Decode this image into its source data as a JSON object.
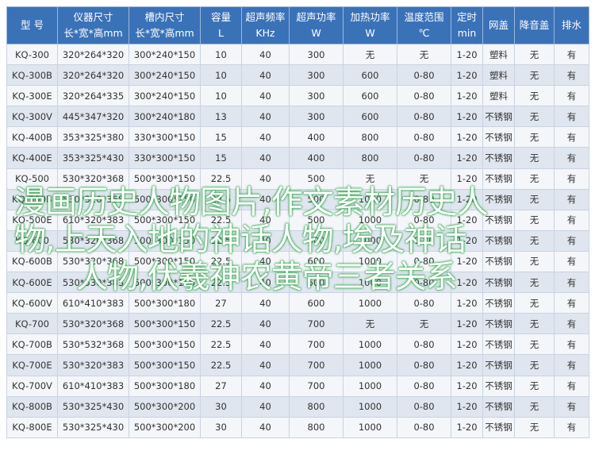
{
  "headers": [
    [
      "型 号"
    ],
    [
      "仪器尺寸",
      "长*宽*高mm"
    ],
    [
      "槽内尺寸",
      "长*宽*高mm"
    ],
    [
      "容量",
      "L"
    ],
    [
      "超声频率",
      "KHz"
    ],
    [
      "超声功率",
      "W"
    ],
    [
      "加热功率",
      "W"
    ],
    [
      "温度范围",
      "℃"
    ],
    [
      "定时",
      "min"
    ],
    [
      "网盖"
    ],
    [
      "降音盖"
    ],
    [
      "排水"
    ]
  ],
  "rows": [
    [
      "KQ-300",
      "320*264*320",
      "300*240*150",
      "10",
      "40",
      "300",
      "无",
      "无",
      "1-20",
      "塑料",
      "无",
      "有"
    ],
    [
      "KQ-300B",
      "320*264*320",
      "300*240*150",
      "10",
      "40",
      "300",
      "600",
      "0-80",
      "1-20",
      "塑料",
      "无",
      "有"
    ],
    [
      "KQ-300E",
      "320*264*335",
      "300*240*150",
      "10",
      "40",
      "300",
      "600",
      "0-80",
      "1-20",
      "塑料",
      "无",
      "有"
    ],
    [
      "KQ-300V",
      "445*347*320",
      "300*240*180",
      "13",
      "40",
      "300",
      "600",
      "0-80",
      "1-20",
      "不锈钢",
      "无",
      "有"
    ],
    [
      "KQ-400B",
      "353*325*380",
      "330*300*150",
      "15",
      "40",
      "400",
      "800",
      "0-80",
      "1-20",
      "不锈钢",
      "无",
      "有"
    ],
    [
      "KQ-400E",
      "353*325*430",
      "330*300*150",
      "15",
      "40",
      "400",
      "800",
      "0-80",
      "1-20",
      "不锈钢",
      "无",
      "有"
    ],
    [
      "KQ-500",
      "530*320*368",
      "500*300*150",
      "22.5",
      "40",
      "500",
      "无",
      "无",
      "1-20",
      "不锈钢",
      "无",
      "有"
    ],
    [
      "KQ-500B",
      "530*320*368",
      "500*300*150",
      "22.5",
      "40",
      "500",
      "1000",
      "0-80",
      "1-20",
      "不锈钢",
      "无",
      "有"
    ],
    [
      "KQ-500E",
      "610*320*383",
      "500*300*150",
      "22.5",
      "40",
      "500",
      "1000",
      "0-80",
      "1-20",
      "不锈钢",
      "无",
      "有"
    ],
    [
      "KQ-600",
      "530*320*368",
      "500*300*150",
      "22.5",
      "40",
      "600",
      "1000",
      "0-80",
      "1-20",
      "不锈钢",
      "无",
      "有"
    ],
    [
      "KQ-600B",
      "530*320*368",
      "500*300*150",
      "22.5",
      "40",
      "600",
      "1000",
      "0-80",
      "1-20",
      "不锈钢",
      "无",
      "有"
    ],
    [
      "KQ-600E",
      "530*530*383",
      "500*300*150",
      "22.5",
      "40",
      "600",
      "1000",
      "0-80",
      "1-20",
      "不锈钢",
      "无",
      "有"
    ],
    [
      "KQ-600V",
      "610*410*383",
      "500*300*180",
      "27",
      "40",
      "600",
      "1000",
      "0-80",
      "1-20",
      "不锈钢",
      "无",
      "有"
    ],
    [
      "KQ-700",
      "530*320*368",
      "500*300*150",
      "22.5",
      "40",
      "700",
      "无",
      "无",
      "1-20",
      "不锈钢",
      "无",
      "有"
    ],
    [
      "KQ-700B",
      "530*532*368",
      "500*300*150",
      "22.5",
      "40",
      "700",
      "1000",
      "0-80",
      "1-20",
      "不锈钢",
      "无",
      "有"
    ],
    [
      "KQ-700E",
      "530*320*383",
      "500*300*150",
      "22.5",
      "40",
      "700",
      "1000",
      "0-80",
      "1-20",
      "不锈钢",
      "无",
      "有"
    ],
    [
      "KQ-700V",
      "610*410*383",
      "500*300*180",
      "27",
      "40",
      "700",
      "1000",
      "0-80",
      "1-20",
      "不锈钢",
      "无",
      "有"
    ],
    [
      "KQ-800B",
      "530*325*430",
      "500*300*200",
      "30",
      "40",
      "800",
      "1000",
      "0-80",
      "1-20",
      "不锈钢",
      "无",
      "有"
    ],
    [
      "KQ-800E",
      "530*325*430",
      "500*300*200",
      "30",
      "40",
      "800",
      "1000",
      "0-80",
      "1-20",
      "不锈钢",
      "无",
      "有"
    ]
  ],
  "overlay_lines": [
    "漫画历史人物图片,作文素材历史人",
    "物,上天入地的神话人物,埃及神话",
    "人物,伏羲神农黄帝三者关系"
  ],
  "colors": {
    "header_bg": "#3a72b8",
    "row_even": "#dfe6ef",
    "row_odd": "#f4f6fa",
    "overlay_glow": "#2fa648"
  }
}
